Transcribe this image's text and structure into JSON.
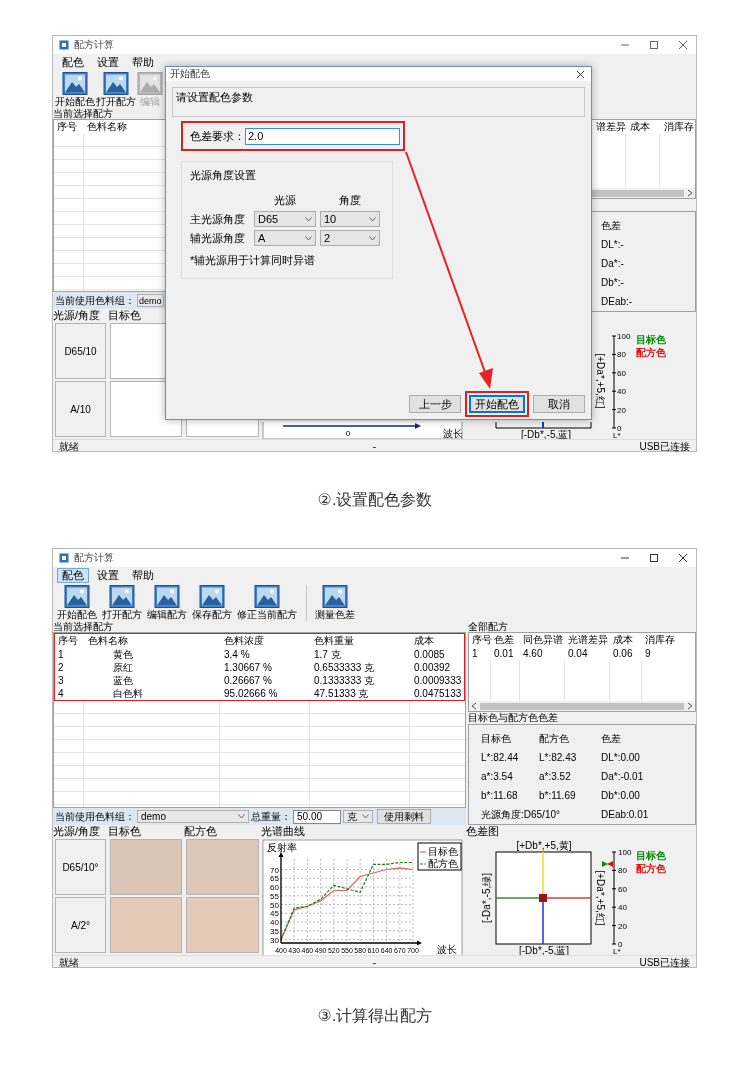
{
  "screenshot_1": {
    "window": {
      "title": "配方计算"
    },
    "menu": [
      {
        "label": "配色",
        "selected": false
      },
      {
        "label": "设置",
        "selected": false
      },
      {
        "label": "帮助",
        "selected": false
      }
    ],
    "toolbar": [
      {
        "label": "开始配色",
        "disabled": false,
        "separator_before": false
      },
      {
        "label": "打开配方",
        "disabled": false,
        "separator_before": false
      },
      {
        "label": "编辑",
        "disabled": true,
        "separator_before": false
      }
    ],
    "recipe_table": {
      "title": "当前选择配方",
      "columns": [
        "序号",
        "色料名称"
      ]
    },
    "all_recipes": {
      "columns": [
        "谱差异",
        "成本",
        "消库存"
      ]
    },
    "difference": {
      "title": "色差",
      "values": [
        "DL*:-",
        "Da*:-",
        "Db*:-",
        "DEab:-"
      ]
    },
    "colorant_group": {
      "label": "当前使用色料组：",
      "value": "demo"
    },
    "preview": {
      "columns": [
        "光源/角度",
        "目标色"
      ],
      "rows": [
        "D65/10",
        "A/10"
      ]
    },
    "spectrum": {
      "tick": "0",
      "xlabel": "波长"
    },
    "diff_chart": {
      "bottom_label": "[-Db*,-5,蓝]",
      "right_label": "[+Da*,+5,红]",
      "scale": [
        "100",
        "80",
        "60",
        "40",
        "20",
        "0"
      ],
      "scale_label": "L*",
      "legend": [
        {
          "label": "目标色",
          "color": "#0a8a0a"
        },
        {
          "label": "配方色",
          "color": "#e01010"
        }
      ]
    },
    "status_bar": {
      "left": "就绪",
      "center": "-",
      "right": "USB已连接"
    },
    "dialog": {
      "title": "开始配色",
      "heading": "请设置配色参数",
      "tolerance": {
        "label": "色差要求：",
        "value": "2.0"
      },
      "group": {
        "title": "光源角度设置",
        "columns": [
          "光源",
          "角度"
        ],
        "rows": [
          {
            "label": "主光源角度",
            "light": "D65",
            "angle": "10"
          },
          {
            "label": "辅光源角度",
            "light": "A",
            "angle": "2"
          }
        ],
        "note": "*辅光源用于计算同时异谱"
      },
      "buttons": [
        {
          "label": "上一步",
          "default": false
        },
        {
          "label": "开始配色",
          "default": true
        },
        {
          "label": "取消",
          "default": false
        }
      ]
    }
  },
  "caption_1": "②.设置配色参数",
  "screenshot_2": {
    "window": {
      "title": "配方计算"
    },
    "menu": [
      {
        "label": "配色",
        "selected": true
      },
      {
        "label": "设置",
        "selected": false
      },
      {
        "label": "帮助",
        "selected": false
      }
    ],
    "toolbar": [
      {
        "label": "开始配色",
        "disabled": false,
        "separator_before": false
      },
      {
        "label": "打开配方",
        "disabled": false,
        "separator_before": false
      },
      {
        "label": "编辑配方",
        "disabled": false,
        "separator_before": false
      },
      {
        "label": "保存配方",
        "disabled": false,
        "separator_before": false
      },
      {
        "label": "修正当前配方",
        "disabled": false,
        "separator_before": false
      },
      {
        "label": "测量色差",
        "disabled": false,
        "separator_before": true
      }
    ],
    "recipe_table": {
      "title": "当前选择配方",
      "columns": [
        "序号",
        "色料名称",
        "色料浓度",
        "色料重量",
        "成本"
      ],
      "rows": [
        [
          "1",
          "黄色",
          "3.4 %",
          "1.7 克",
          "0.0085"
        ],
        [
          "2",
          "原红",
          "1.30667 %",
          "0.6533333 克",
          "0.00392"
        ],
        [
          "3",
          "蓝色",
          "0.26667 %",
          "0.1333333 克",
          "0.0009333"
        ],
        [
          "4",
          "白色料",
          "95.02666 %",
          "47.51333 克",
          "0.0475133"
        ]
      ]
    },
    "colorant_group": {
      "label": "当前使用色料组：",
      "value": "demo",
      "weight_label": "总重量：",
      "weight": "50.00",
      "unit": "克",
      "button": "使用剩料"
    },
    "all_recipes": {
      "title": "全部配方",
      "columns": [
        "序号",
        "色差",
        "同色异谱",
        "光谱差异",
        "成本",
        "消库存"
      ],
      "rows": [
        [
          "1",
          "0.01",
          "4.60",
          "0.04",
          "0.06",
          "9"
        ]
      ]
    },
    "difference": {
      "title": "目标色与配方色色差",
      "columns": [
        "目标色",
        "配方色",
        "色差"
      ],
      "rows": [
        [
          "L*:82.44",
          "L*:82.43",
          "DL*:0.00"
        ],
        [
          "a*:3.54",
          "a*:3.52",
          "Da*:-0.01"
        ],
        [
          "b*:11.68",
          "b*:11.69",
          "Db*:0.00"
        ]
      ],
      "illuminant": "光源角度:D65/10°",
      "deab": "DEab:0.01"
    },
    "preview": {
      "columns": [
        "光源/角度",
        "目标色",
        "配方色"
      ],
      "rows": [
        {
          "light": "D65/10°",
          "swatches": [
            {
              "color": "#dbc5b5"
            },
            {
              "color": "#dcc6b5"
            }
          ]
        },
        {
          "light": "A/2°",
          "swatches": [
            {
              "color": "#e5c9b7"
            },
            {
              "color": "#e6cab8"
            }
          ]
        }
      ]
    },
    "spectrum": {
      "title": "光谱曲线",
      "chart_data": {
        "type": "line",
        "ylabel": "反射率",
        "xlabel": "波长",
        "x": [
          400,
          430,
          460,
          490,
          520,
          550,
          580,
          610,
          640,
          670,
          700
        ],
        "series": [
          {
            "name": "目标色",
            "color": "#e06060",
            "line_style": "solid",
            "values": [
              30,
              47,
              49,
              52,
              58,
              58,
              66,
              68,
              70,
              71,
              70
            ]
          },
          {
            "name": "配方色",
            "color": "#208020",
            "line_style": "dashed",
            "values": [
              30,
              48,
              49,
              53,
              61,
              59,
              57,
              73,
              73,
              74,
              74
            ]
          }
        ],
        "xlim": [
          400,
          700
        ],
        "ylim": [
          28,
          76
        ],
        "xticks": [
          400,
          430,
          460,
          490,
          520,
          550,
          580,
          610,
          640,
          670,
          700
        ],
        "yticks": [
          30,
          35,
          40,
          45,
          50,
          55,
          60,
          65,
          70
        ],
        "grid": true,
        "legend": true
      }
    },
    "diff_chart": {
      "title": "色差图",
      "top_label": "[+Db*,+5,黄]",
      "bottom_label": "[-Db*,-5,蓝]",
      "left_label": "[-Da*,-5,绿]",
      "right_label": "[+Da*,+5,红]",
      "scale": [
        "100",
        "80",
        "60",
        "40",
        "20",
        "0"
      ],
      "scale_label": "L*",
      "legend": [
        {
          "label": "目标色",
          "color": "#0a8a0a"
        },
        {
          "label": "配方色",
          "color": "#e01010"
        }
      ]
    },
    "status_bar": {
      "left": "就绪",
      "center": "-",
      "right": "USB已连接"
    }
  },
  "caption_2": "③.计算得出配方"
}
